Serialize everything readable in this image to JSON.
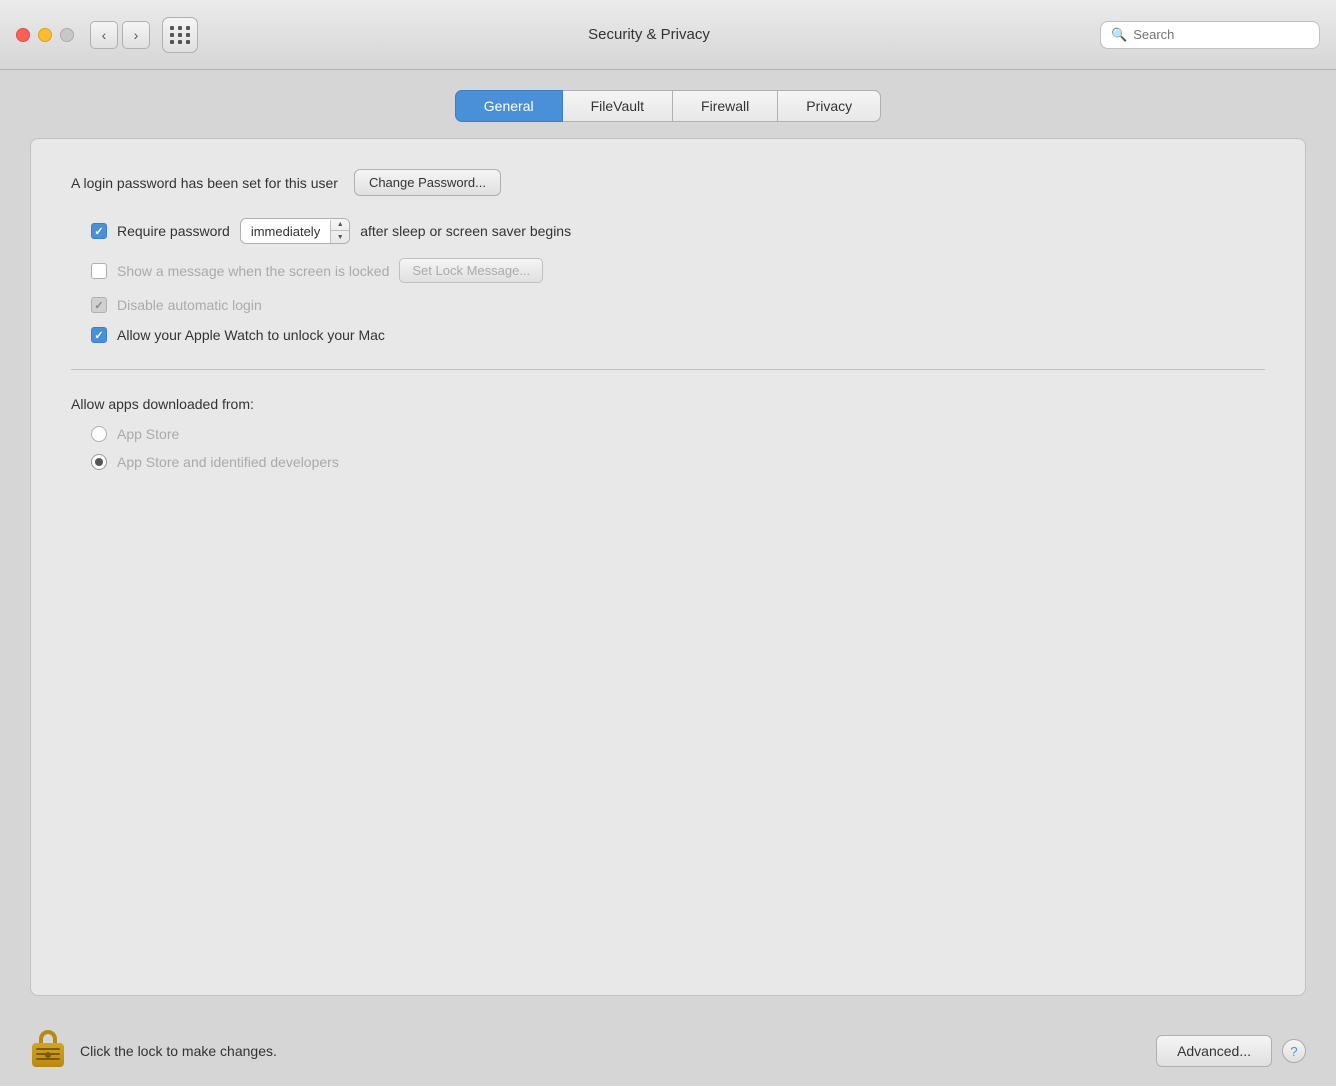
{
  "titlebar": {
    "title": "Security & Privacy",
    "search_placeholder": "Search",
    "nav_back_label": "‹",
    "nav_forward_label": "›"
  },
  "tabs": [
    {
      "id": "general",
      "label": "General",
      "active": true
    },
    {
      "id": "filevault",
      "label": "FileVault",
      "active": false
    },
    {
      "id": "firewall",
      "label": "Firewall",
      "active": false
    },
    {
      "id": "privacy",
      "label": "Privacy",
      "active": false
    }
  ],
  "general": {
    "password_label": "A login password has been set for this user",
    "change_password_btn": "Change Password...",
    "require_password_label": "Require password",
    "require_password_value": "immediately",
    "require_password_suffix": "after sleep or screen saver begins",
    "show_message_label": "Show a message when the screen is locked",
    "set_lock_message_btn": "Set Lock Message...",
    "disable_autologin_label": "Disable automatic login",
    "apple_watch_label": "Allow your Apple Watch to unlock your Mac",
    "require_password_checked": true,
    "show_message_checked": false,
    "disable_autologin_checked": true,
    "apple_watch_checked": true,
    "downloads_title": "Allow apps downloaded from:",
    "radio_app_store": "App Store",
    "radio_app_store_identified": "App Store and identified developers",
    "radio_selected": "app_store_identified"
  },
  "bottom": {
    "lock_text": "Click the lock to make changes.",
    "advanced_btn": "Advanced...",
    "help_btn": "?"
  },
  "icons": {
    "search": "🔍",
    "lock": "🔒",
    "help": "?"
  }
}
